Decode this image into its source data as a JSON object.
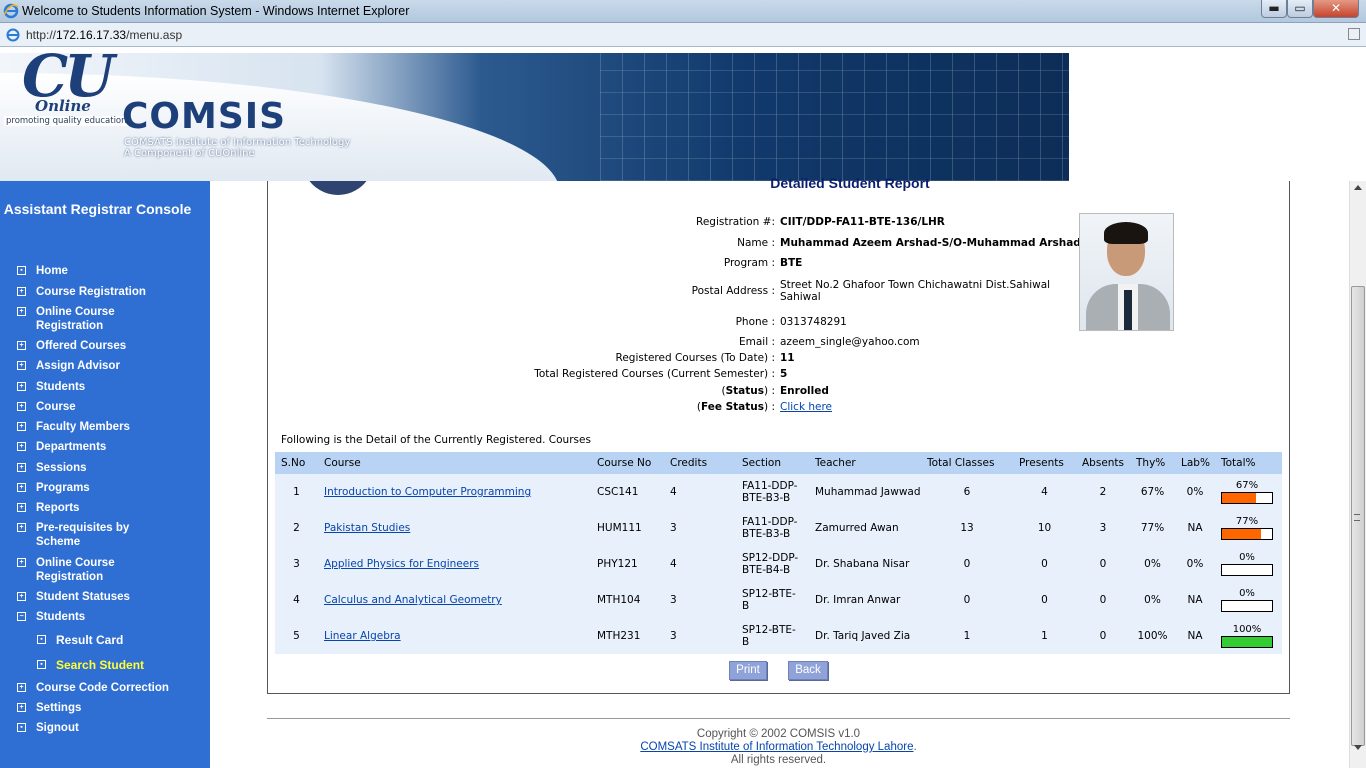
{
  "window": {
    "title": "Welcome to Students Information System - Windows Internet Explorer",
    "url_prefix": "http://",
    "url_host": "172.16.17.33",
    "url_path": "/menu.asp",
    "min_glyph": "▬",
    "max_glyph": "▭",
    "close_glyph": "✕"
  },
  "banner": {
    "logo_cu": "CU",
    "logo_online": "Online",
    "logo_tag": "promoting quality education",
    "brand": "COMSIS",
    "subtitle1": "COMSATS Institute of Information Technology",
    "subtitle2": "A Component of CUOnline"
  },
  "sidebar": {
    "console_title": "Assistant Registrar Console",
    "items": [
      {
        "label": "Home"
      },
      {
        "label": "Course Registration"
      },
      {
        "label": "Online Course Registration"
      },
      {
        "label": "Offered Courses"
      },
      {
        "label": "Assign Advisor"
      },
      {
        "label": "Students"
      },
      {
        "label": "Course"
      },
      {
        "label": "Faculty Members"
      },
      {
        "label": "Departments"
      },
      {
        "label": "Sessions"
      },
      {
        "label": "Programs"
      },
      {
        "label": "Reports"
      },
      {
        "label": "Pre-requisites by Scheme"
      },
      {
        "label": "Online Course Registration"
      },
      {
        "label": "Student Statuses"
      },
      {
        "label": "Students"
      },
      {
        "label": "Course Code Correction"
      },
      {
        "label": "Settings"
      },
      {
        "label": "Signout"
      }
    ],
    "subitems": [
      {
        "label": "Result Card"
      },
      {
        "label": "Search Student"
      }
    ]
  },
  "report": {
    "title": "Detailed Student Report",
    "fields": {
      "registration": {
        "label": "Registration #:",
        "value": "CIIT/DDP-FA11-BTE-136/LHR"
      },
      "name": {
        "label": "Name :",
        "value": "Muhammad Azeem Arshad-S/O-Muhammad Arshad"
      },
      "program": {
        "label": "Program :",
        "value": "BTE"
      },
      "address": {
        "label": "Postal Address :",
        "value1": "Street No.2 Ghafoor Town Chichawatni Dist.Sahiwal",
        "value2": "Sahiwal"
      },
      "phone": {
        "label": "Phone :",
        "value": "0313748291"
      },
      "email": {
        "label": "Email :",
        "value": "azeem_single@yahoo.com"
      },
      "registered_to_date": {
        "label": "Registered Courses (To Date) :",
        "value": "11"
      },
      "total_current": {
        "label": "Total Registered Courses (Current Semester) :",
        "value": "5"
      },
      "status": {
        "label_open": "(",
        "label_word": "Status",
        "label_close": ") :",
        "value": "Enrolled"
      },
      "fee_status": {
        "label_open": "(",
        "label_word": "Fee Status",
        "label_close": ") :",
        "value": "Click here"
      }
    },
    "caption": "Following is the Detail of the Currently Registered. Courses",
    "columns": [
      "S.No",
      "Course",
      "Course No",
      "Credits",
      "Section",
      "Teacher",
      "Total Classes",
      "Presents",
      "Absents",
      "Thy%",
      "Lab%",
      "Total%"
    ],
    "rows": [
      {
        "sno": "1",
        "course": "Introduction to Computer Programming",
        "course_no": "CSC141",
        "credits": "4",
        "section": "FA11-DDP-BTE-B3-B",
        "section1": "FA11-DDP-",
        "section2": "BTE-B3-B",
        "teacher": "Muhammad Jawwad",
        "total_classes": "6",
        "presents": "4",
        "absents": "2",
        "thy": "67%",
        "lab": "0%",
        "total_label": "67%",
        "total_fraction": 0.67,
        "bar_color": "#ff6600"
      },
      {
        "sno": "2",
        "course": "Pakistan Studies",
        "course_no": "HUM111",
        "credits": "3",
        "section1": "FA11-DDP-",
        "section2": "BTE-B3-B",
        "teacher": "Zamurred Awan",
        "total_classes": "13",
        "presents": "10",
        "absents": "3",
        "thy": "77%",
        "lab": "NA",
        "total_label": "77%",
        "total_fraction": 0.77,
        "bar_color": "#ff6600"
      },
      {
        "sno": "3",
        "course": "Applied Physics for Engineers",
        "course_no": "PHY121",
        "credits": "4",
        "section1": "SP12-DDP-",
        "section2": "BTE-B4-B",
        "teacher": "Dr. Shabana Nisar",
        "total_classes": "0",
        "presents": "0",
        "absents": "0",
        "thy": "0%",
        "lab": "0%",
        "total_label": "0%",
        "total_fraction": 0,
        "bar_color": "#ff6600"
      },
      {
        "sno": "4",
        "course": "Calculus and Analytical Geometry",
        "course_no": "MTH104",
        "credits": "3",
        "section1": "SP12-BTE-",
        "section2": "B",
        "teacher": "Dr. Imran Anwar",
        "total_classes": "0",
        "presents": "0",
        "absents": "0",
        "thy": "0%",
        "lab": "NA",
        "total_label": "0%",
        "total_fraction": 0,
        "bar_color": "#ff6600"
      },
      {
        "sno": "5",
        "course": "Linear Algebra",
        "course_no": "MTH231",
        "credits": "3",
        "section1": "SP12-BTE-",
        "section2": "B",
        "teacher": "Dr. Tariq Javed Zia",
        "total_classes": "1",
        "presents": "1",
        "absents": "0",
        "thy": "100%",
        "lab": "NA",
        "total_label": "100%",
        "total_fraction": 1.0,
        "bar_color": "#33cc33"
      }
    ],
    "buttons": {
      "print": "Print",
      "back": "Back"
    }
  },
  "footer": {
    "copyright": "Copyright © 2002 COMSIS v1.0",
    "link": "COMSATS Institute of Information Technology Lahore",
    "link_suffix": ".",
    "rights": "All rights reserved."
  }
}
